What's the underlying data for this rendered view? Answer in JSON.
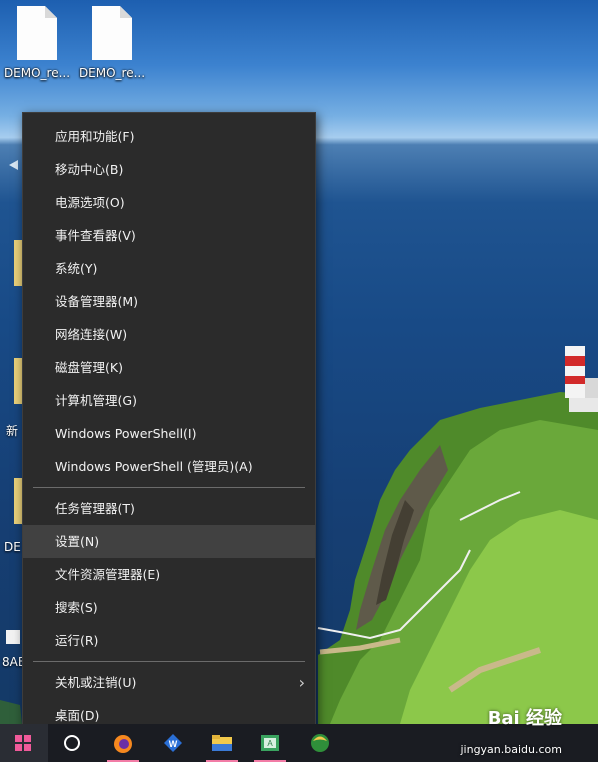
{
  "desktop": {
    "icons": [
      {
        "label": "DEMO_re..."
      },
      {
        "label": "DEMO_re..."
      }
    ],
    "partial_labels": [
      "新",
      "DE",
      "8AE"
    ]
  },
  "context_menu": {
    "group1": [
      {
        "label": "应用和功能(F)"
      },
      {
        "label": "移动中心(B)"
      },
      {
        "label": "电源选项(O)"
      },
      {
        "label": "事件查看器(V)"
      },
      {
        "label": "系统(Y)"
      },
      {
        "label": "设备管理器(M)"
      },
      {
        "label": "网络连接(W)"
      },
      {
        "label": "磁盘管理(K)"
      },
      {
        "label": "计算机管理(G)"
      },
      {
        "label": "Windows PowerShell(I)"
      },
      {
        "label": "Windows PowerShell (管理员)(A)"
      }
    ],
    "group2": [
      {
        "label": "任务管理器(T)"
      },
      {
        "label": "设置(N)",
        "highlighted": true
      },
      {
        "label": "文件资源管理器(E)"
      },
      {
        "label": "搜索(S)"
      },
      {
        "label": "运行(R)"
      }
    ],
    "group3": [
      {
        "label": "关机或注销(U)",
        "has_submenu": true
      },
      {
        "label": "桌面(D)"
      }
    ]
  },
  "taskbar": {
    "items": [
      "start-button",
      "search-cortana",
      "firefox",
      "wps",
      "file-explorer",
      "image-app",
      "kingsoft-app"
    ],
    "accent_color": "#f27ca6"
  },
  "watermark": {
    "brand": "Bai 经验",
    "url": "jingyan.baidu.com"
  }
}
